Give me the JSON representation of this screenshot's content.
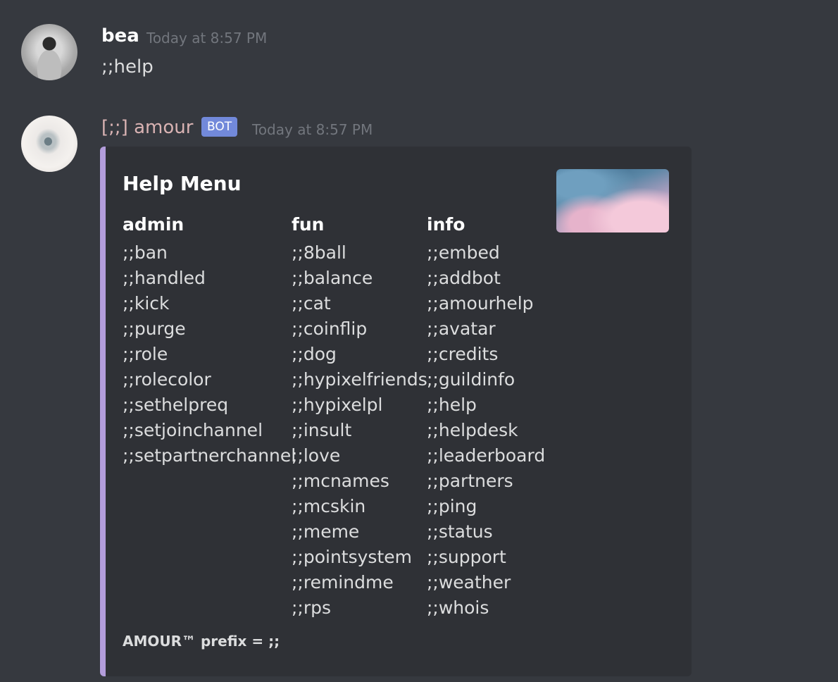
{
  "messages": [
    {
      "username": "bea",
      "username_color": "#ffffff",
      "timestamp": "Today at 8:57 PM",
      "content": ";;help"
    },
    {
      "username": "[;;] amour",
      "username_color": "#d9b3b3",
      "badge": "BOT",
      "timestamp": "Today at 8:57 PM"
    }
  ],
  "embed": {
    "accent_color": "#b39ddb",
    "title": "Help Menu",
    "columns": [
      {
        "header": "admin",
        "items": [
          ";;ban",
          ";;handled",
          ";;kick",
          ";;purge",
          ";;role",
          ";;rolecolor",
          ";;sethelpreq",
          ";;setjoinchannel",
          ";;setpartnerchannel"
        ]
      },
      {
        "header": "fun",
        "items": [
          ";;8ball",
          ";;balance",
          ";;cat",
          ";;coinflip",
          ";;dog",
          ";;hypixelfriends",
          ";;hypixelpl",
          ";;insult",
          ";;love",
          ";;mcnames",
          ";;mcskin",
          ";;meme",
          ";;pointsystem",
          ";;remindme",
          ";;rps"
        ]
      },
      {
        "header": "info",
        "items": [
          ";;embed",
          ";;addbot",
          ";;amourhelp",
          ";;avatar",
          ";;credits",
          ";;guildinfo",
          ";;help",
          ";;helpdesk",
          ";;leaderboard",
          ";;partners",
          ";;ping",
          ";;status",
          ";;support",
          ";;weather",
          ";;whois"
        ]
      }
    ],
    "footer": "AMOUR™ prefix = ;;"
  }
}
